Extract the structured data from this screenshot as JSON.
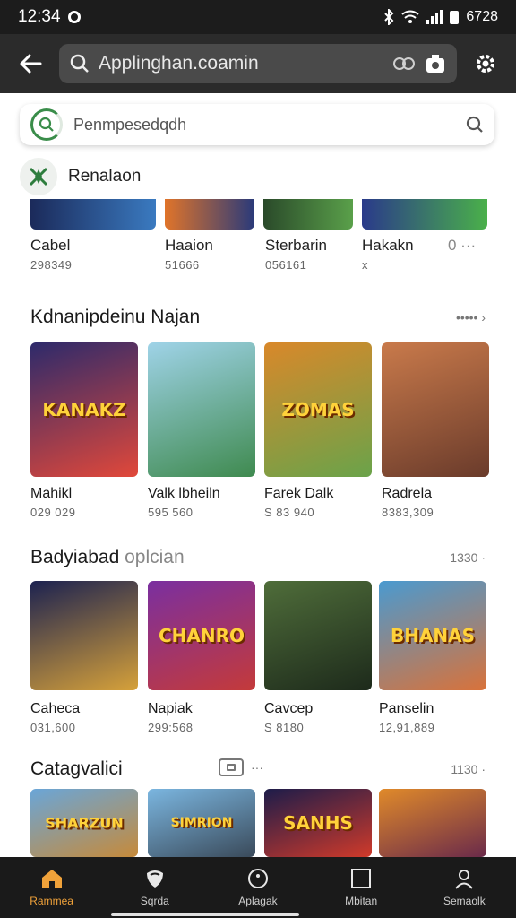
{
  "status": {
    "time": "12:34",
    "right_text": "6728"
  },
  "app_bar": {
    "url": "Applinghan.coamin"
  },
  "search": {
    "placeholder": "Penmpesedqdh"
  },
  "recommend": {
    "title": "Renalaon"
  },
  "top_strip": [
    {
      "name": "Cabel",
      "value": "298349"
    },
    {
      "name": "Haaion",
      "value": "51666"
    },
    {
      "name": "Sterbarin",
      "value": "056161"
    },
    {
      "name": "Hakakn",
      "value": "x",
      "extra": "0 ···"
    }
  ],
  "sections": [
    {
      "title": "Kdnanipdeinu Najan",
      "title_light": "",
      "more": "••••• ›",
      "items": [
        {
          "name": "Mahikl",
          "value": "029 029",
          "art": "KANAKZ",
          "colors": [
            "#2d2a6b",
            "#e1483a"
          ]
        },
        {
          "name": "Valk lbheiln",
          "value": "595 560",
          "art": "",
          "colors": [
            "#3f8a4f",
            "#9fd3e8"
          ]
        },
        {
          "name": "Farek Dalk",
          "value": "S 83 940",
          "art": "ZOMAS",
          "colors": [
            "#d9882a",
            "#6aa34a"
          ]
        },
        {
          "name": "Radrela",
          "value": "8383,309",
          "art": "",
          "colors": [
            "#6a3b2b",
            "#c97a4b"
          ]
        }
      ]
    },
    {
      "title": "Badyiabad",
      "title_light": "oplcian",
      "more": "1330 ·",
      "items": [
        {
          "name": "Caheca",
          "value": "031,600",
          "art": "",
          "colors": [
            "#1c2250",
            "#d6a13a"
          ]
        },
        {
          "name": "Napiak",
          "value": "299:568",
          "art": "CHANRO",
          "colors": [
            "#7a2fa0",
            "#c43a3a"
          ]
        },
        {
          "name": "Cavcep",
          "value": "S 8180",
          "art": "",
          "colors": [
            "#1d2a1b",
            "#4f6d3a"
          ]
        },
        {
          "name": "Panselin",
          "value": "12,91,889",
          "art": "BHANAS",
          "colors": [
            "#4a9ad0",
            "#d9723a"
          ]
        }
      ]
    },
    {
      "title": "Catagvalici",
      "title_light": "",
      "more": "1130 ·",
      "items": [
        {
          "art": "SHARZUN",
          "colors": [
            "#6aa6d8",
            "#c68a3a"
          ]
        },
        {
          "art": "SIMRION",
          "colors": [
            "#7bb6e0",
            "#3a4a5a"
          ]
        },
        {
          "art": "SANHS",
          "colors": [
            "#1c1c4a",
            "#d03a2a"
          ]
        },
        {
          "art": "",
          "colors": [
            "#e08a2a",
            "#6a2a4a"
          ]
        }
      ]
    }
  ],
  "bottom_nav": [
    {
      "label": "Rammea",
      "icon": "home-icon",
      "active": true
    },
    {
      "label": "Sqrda",
      "icon": "shield-icon",
      "active": false
    },
    {
      "label": "Aplagak",
      "icon": "circle-dot-icon",
      "active": false
    },
    {
      "label": "Mbitan",
      "icon": "square-icon",
      "active": false
    },
    {
      "label": "Semaolk",
      "icon": "person-icon",
      "active": false
    }
  ],
  "colors": {
    "accent": "#f0a23a",
    "dark_bar": "#2b2b2b",
    "search_green": "#3a8d4a"
  }
}
